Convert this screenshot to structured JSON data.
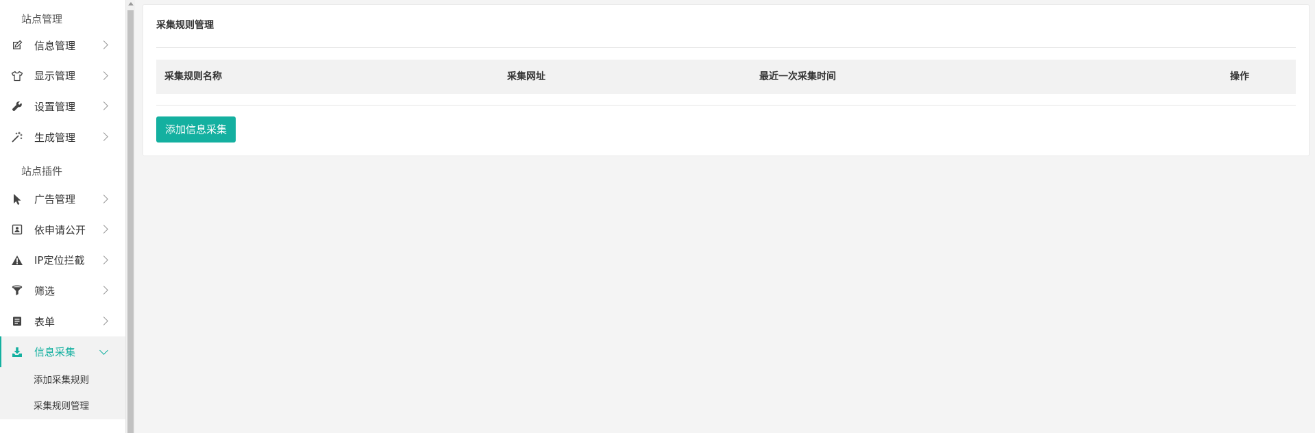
{
  "sidebar": {
    "section1_title": "站点管理",
    "section2_title": "站点插件",
    "group1": [
      {
        "label": "信息管理",
        "icon": "edit-icon"
      },
      {
        "label": "显示管理",
        "icon": "tshirt-icon"
      },
      {
        "label": "设置管理",
        "icon": "wrench-icon"
      },
      {
        "label": "生成管理",
        "icon": "magic-wand-icon"
      }
    ],
    "group2": [
      {
        "label": "广告管理",
        "icon": "cursor-pointer-icon"
      },
      {
        "label": "依申请公开",
        "icon": "contact-card-icon"
      },
      {
        "label": "IP定位拦截",
        "icon": "warning-icon"
      },
      {
        "label": "筛选",
        "icon": "filter-icon"
      },
      {
        "label": "表单",
        "icon": "form-icon"
      },
      {
        "label": "信息采集",
        "icon": "download-icon",
        "active": true
      }
    ],
    "submenu": [
      {
        "label": "添加采集规则"
      },
      {
        "label": "采集规则管理"
      }
    ]
  },
  "panel": {
    "title": "采集规则管理",
    "columns": [
      "采集规则名称",
      "采集网址",
      "最近一次采集时间",
      "操作"
    ],
    "rows": [],
    "add_button_label": "添加信息采集"
  },
  "colors": {
    "accent": "#14b0a0",
    "background": "#f4f4f4",
    "header_bg": "#f2f2f2"
  }
}
